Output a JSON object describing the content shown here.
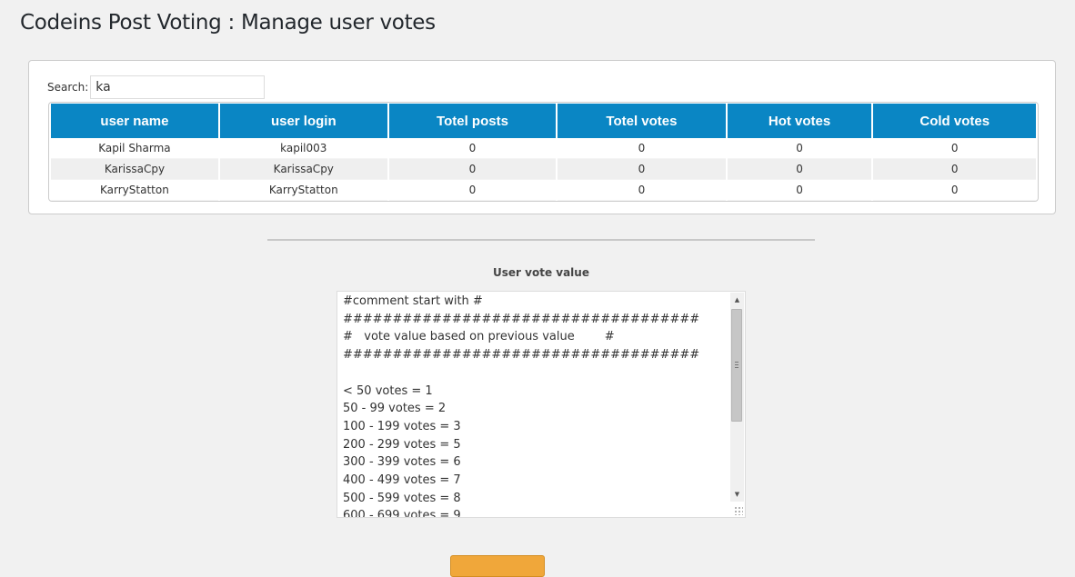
{
  "page": {
    "title": "Codeins Post Voting : Manage user votes"
  },
  "search": {
    "label": "Search:",
    "value": "ka"
  },
  "table": {
    "headers": [
      "user name",
      "user login",
      "Totel posts",
      "Totel votes",
      "Hot votes",
      "Cold votes"
    ],
    "rows": [
      [
        "Kapil Sharma",
        "kapil003",
        "0",
        "0",
        "0",
        "0"
      ],
      [
        "KarissaCpy",
        "KarissaCpy",
        "0",
        "0",
        "0",
        "0"
      ],
      [
        "KarryStatton",
        "KarryStatton",
        "0",
        "0",
        "0",
        "0"
      ]
    ]
  },
  "vote_value": {
    "label": "User vote value",
    "text": "#comment start with #\n####################################\n#   vote value based on previous value        #\n####################################\n\n< 50 votes = 1\n50 - 99 votes = 2\n100 - 199 votes = 3\n200 - 299 votes = 5\n300 - 399 votes = 6\n400 - 499 votes = 7\n500 - 599 votes = 8\n600 - 699 votes = 9"
  },
  "colors": {
    "header_bg": "#0a86c4",
    "button_bg": "#f0a73a"
  }
}
